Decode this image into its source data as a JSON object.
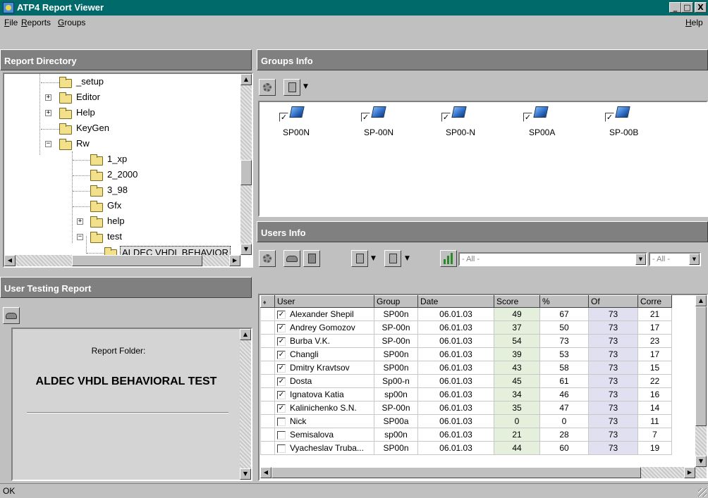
{
  "window": {
    "title": "ATP4 Report Viewer"
  },
  "window_buttons": {
    "minimize": "_",
    "maximize": "□",
    "close": "X"
  },
  "menu": {
    "file": {
      "first": "F",
      "rest": "ile"
    },
    "reports": {
      "first": "R",
      "rest": "eports"
    },
    "groups": {
      "first": "G",
      "rest": "roups"
    },
    "help": {
      "first": "H",
      "rest": "elp"
    }
  },
  "report_directory": {
    "header": "Report Directory",
    "tree": [
      {
        "label": "_setup",
        "expander": ""
      },
      {
        "label": "Editor",
        "expander": "+"
      },
      {
        "label": "Help",
        "expander": "+"
      },
      {
        "label": "KeyGen",
        "expander": ""
      },
      {
        "label": "Rw",
        "expander": "−"
      },
      {
        "label": "1_xp",
        "expander": ""
      },
      {
        "label": "2_2000",
        "expander": ""
      },
      {
        "label": "3_98",
        "expander": ""
      },
      {
        "label": "Gfx",
        "expander": ""
      },
      {
        "label": "help",
        "expander": "+"
      },
      {
        "label": "test",
        "expander": "−"
      },
      {
        "label": "ALDEC VHDL BEHAVIOR",
        "expander": ""
      }
    ]
  },
  "user_testing_report": {
    "header": "User Testing Report",
    "folder_caption": "Report Folder:",
    "folder_name": "ALDEC VHDL BEHAVIORAL TEST"
  },
  "groups_info": {
    "header": "Groups Info",
    "groups": [
      {
        "name": "SP00N",
        "checked": true
      },
      {
        "name": "SP-00N",
        "checked": true
      },
      {
        "name": "SP00-N",
        "checked": true
      },
      {
        "name": "SP00A",
        "checked": true
      },
      {
        "name": "SP-00B",
        "checked": true
      }
    ]
  },
  "users_info": {
    "header": "Users Info",
    "filter_all_1": "- All -",
    "filter_all_2": "- All -",
    "columns": [
      "User",
      "Group",
      "Date",
      "Score",
      "%",
      "Of",
      "Corre"
    ],
    "rows": [
      {
        "checked": true,
        "user": "Alexander Shepil",
        "group": "SP00n",
        "date": "06.01.03",
        "score": "49",
        "pct": "67",
        "of": "73",
        "correct": "21"
      },
      {
        "checked": true,
        "user": "Andrey Gomozov",
        "group": "SP-00n",
        "date": "06.01.03",
        "score": "37",
        "pct": "50",
        "of": "73",
        "correct": "17"
      },
      {
        "checked": true,
        "user": "Burba V.K.",
        "group": "SP-00n",
        "date": "06.01.03",
        "score": "54",
        "pct": "73",
        "of": "73",
        "correct": "23"
      },
      {
        "checked": true,
        "user": "Changli",
        "group": "SP00n",
        "date": "06.01.03",
        "score": "39",
        "pct": "53",
        "of": "73",
        "correct": "17"
      },
      {
        "checked": true,
        "user": "Dmitry Kravtsov",
        "group": "SP00n",
        "date": "06.01.03",
        "score": "43",
        "pct": "58",
        "of": "73",
        "correct": "15"
      },
      {
        "checked": true,
        "user": "Dosta",
        "group": "Sp00-n",
        "date": "06.01.03",
        "score": "45",
        "pct": "61",
        "of": "73",
        "correct": "22"
      },
      {
        "checked": true,
        "user": "Ignatova Katia",
        "group": "sp00n",
        "date": "06.01.03",
        "score": "34",
        "pct": "46",
        "of": "73",
        "correct": "16"
      },
      {
        "checked": true,
        "user": "Kalinichenko S.N.",
        "group": "SP-00n",
        "date": "06.01.03",
        "score": "35",
        "pct": "47",
        "of": "73",
        "correct": "14"
      },
      {
        "checked": false,
        "user": "Nick",
        "group": "SP00a",
        "date": "06.01.03",
        "score": "0",
        "pct": "0",
        "of": "73",
        "correct": "11"
      },
      {
        "checked": false,
        "user": "Semisalova",
        "group": "sp00n",
        "date": "06.01.03",
        "score": "21",
        "pct": "28",
        "of": "73",
        "correct": "7"
      },
      {
        "checked": false,
        "user": "Vyacheslav Truba...",
        "group": "SP00n",
        "date": "06.01.03",
        "score": "44",
        "pct": "60",
        "of": "73",
        "correct": "19"
      }
    ]
  },
  "status": {
    "text": "OK"
  },
  "icons": {
    "checkmark": "✓",
    "arrow_down": "▼",
    "arrow_up": "▲",
    "arrow_left": "◀",
    "arrow_right": "▶"
  }
}
